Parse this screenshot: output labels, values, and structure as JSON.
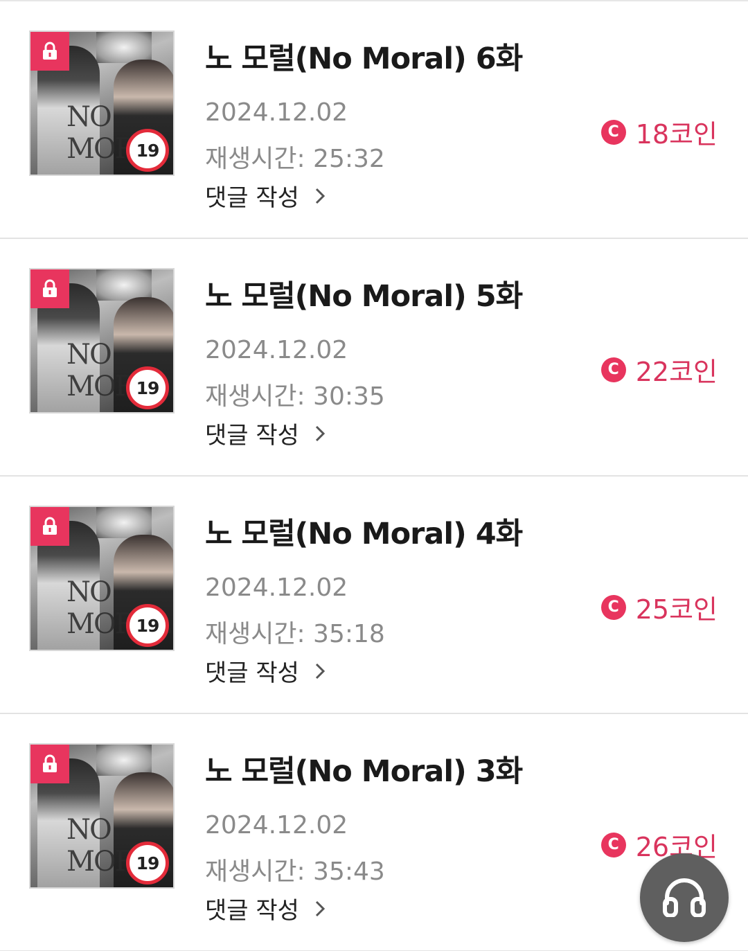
{
  "episodes": [
    {
      "title": "노 모럴(No Moral) 6화",
      "date": "2024.12.02",
      "runtime_label": "재생시간: 25:32",
      "comment_label": "댓글 작성",
      "price": "18코인"
    },
    {
      "title": "노 모럴(No Moral) 5화",
      "date": "2024.12.02",
      "runtime_label": "재생시간: 30:35",
      "comment_label": "댓글 작성",
      "price": "22코인"
    },
    {
      "title": "노 모럴(No Moral) 4화",
      "date": "2024.12.02",
      "runtime_label": "재생시간: 35:18",
      "comment_label": "댓글 작성",
      "price": "25코인"
    },
    {
      "title": "노 모럴(No Moral) 3화",
      "date": "2024.12.02",
      "runtime_label": "재생시간: 35:43",
      "comment_label": "댓글 작성",
      "price": "26코인"
    }
  ],
  "thumbnail": {
    "logo_text": "NO MORAL",
    "age_rating": "19",
    "lock_icon": "lock-icon"
  },
  "coin_symbol": "C",
  "colors": {
    "accent": "#e8355e",
    "price_text": "#d9345d",
    "age_ring": "#e32b3a",
    "fab_bg": "#5f5f5f"
  },
  "fab": {
    "icon": "headphones-icon"
  }
}
